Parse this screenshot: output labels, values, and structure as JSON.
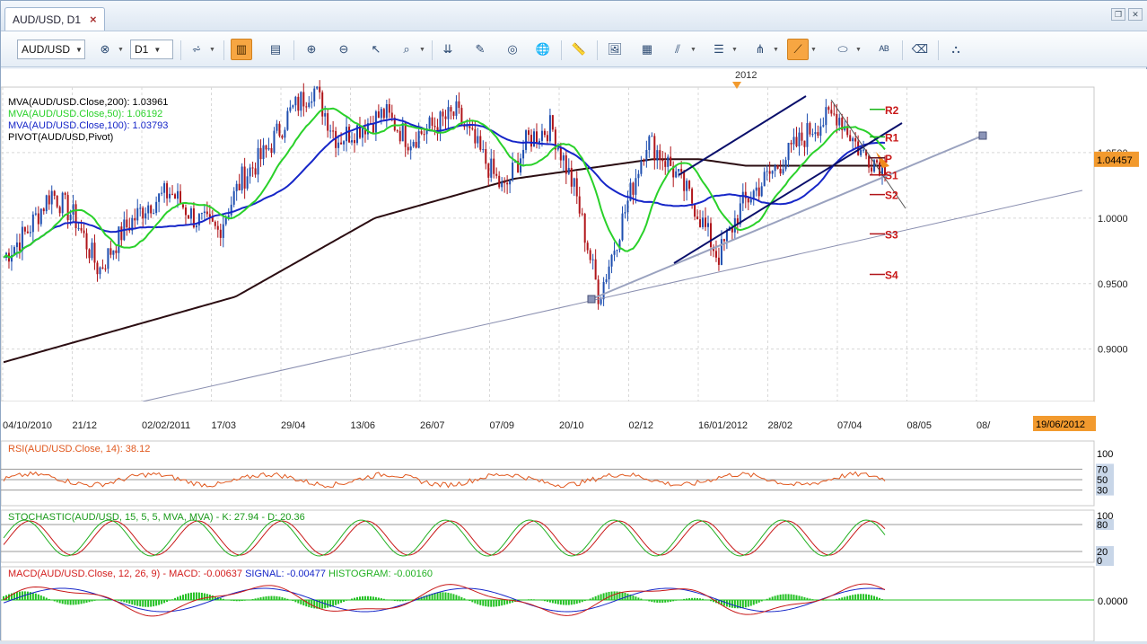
{
  "window": {
    "tab_title": "AUD/USD, D1",
    "tab_close": "×"
  },
  "toolbar": {
    "symbol": "AUD/USD",
    "timeframe": "D1",
    "icons": [
      "bar-chart-icon",
      "delete-symbol-icon",
      "chart-type-icon",
      "candles-icon",
      "indicators-icon",
      "zoom-in-icon",
      "zoom-out-icon",
      "cursor-icon",
      "zoom-area-icon",
      "autoscroll-icon",
      "grid-icon",
      "history-icon",
      "globe-icon",
      "ruler-icon",
      "screenshot-icon",
      "template-icon",
      "fibonacci-icon",
      "channel-icon",
      "pitchfork-icon",
      "trendline-icon",
      "ellipse-icon",
      "text-label-icon",
      "eraser-icon",
      "objects-tree-icon"
    ]
  },
  "main": {
    "year_marker": "2012",
    "legend": [
      {
        "text": "MVA(AUD/USD.Close,200): 1.03961",
        "color": "#2b0d12"
      },
      {
        "text": "MVA(AUD/USD.Close,50): 1.06192",
        "color": "#2ad12a"
      },
      {
        "text": "MVA(AUD/USD.Close,100): 1.03793",
        "color": "#1626c8"
      },
      {
        "text": "PIVOT(AUD/USD,Pivot)",
        "color": "#111111"
      }
    ],
    "y_ticks": [
      "1.0500",
      "1.0000",
      "0.9500",
      "0.9000"
    ],
    "price_label": "1.04457",
    "x_ticks": [
      "04/10/2010",
      "21/12",
      "02/02/2011",
      "17/03",
      "29/04",
      "13/06",
      "26/07",
      "07/09",
      "20/10",
      "02/12",
      "16/01/2012",
      "28/02",
      "07/04",
      "08/05",
      "08/"
    ],
    "date_label": "19/06/2012",
    "pivots": [
      "R2",
      "R1",
      "P",
      "S1",
      "S2",
      "S3",
      "S4"
    ]
  },
  "rsi": {
    "label": "RSI(AUD/USD.Close, 14): 38.12",
    "ticks": [
      "100",
      "70",
      "50",
      "30"
    ]
  },
  "stochastic": {
    "label": "STOCHASTIC(AUD/USD, 15, 5, 5, MVA, MVA) - K: 27.94 - D: 20.36",
    "ticks": [
      "100",
      "80",
      "20",
      "0"
    ]
  },
  "macd": {
    "label_1": "MACD(AUD/USD.Close, 12, 26, 9) - MACD: -0.00637",
    "label_2": "SIGNAL: -0.00477",
    "label_3": "HISTOGRAM: -0.00160",
    "ticks": [
      "0.0000"
    ]
  },
  "chart_data": {
    "type": "candlestick",
    "instrument": "AUD/USD",
    "timeframe": "D1",
    "ylim": [
      0.86,
      1.1
    ],
    "moving_averages": [
      {
        "name": "MVA200",
        "color": "#2b0d12",
        "last": 1.03961
      },
      {
        "name": "MVA50",
        "color": "#2ad12a",
        "last": 1.06192
      },
      {
        "name": "MVA100",
        "color": "#1626c8",
        "last": 1.03793
      }
    ],
    "close_path": [
      0.97,
      0.99,
      1.02,
      1.0,
      0.96,
      0.99,
      1.01,
      1.02,
      1.0,
      0.99,
      1.03,
      1.05,
      1.08,
      1.1,
      1.06,
      1.07,
      1.08,
      1.06,
      1.07,
      1.08,
      1.05,
      1.02,
      1.06,
      1.07,
      1.02,
      0.94,
      1.0,
      1.06,
      1.04,
      1.01,
      0.97,
      1.01,
      1.03,
      1.05,
      1.07,
      1.08,
      1.05,
      1.04
    ],
    "ma200_path": [
      0.89,
      0.9,
      0.91,
      0.92,
      0.93,
      0.94,
      0.96,
      0.98,
      1.0,
      1.01,
      1.02,
      1.03,
      1.035,
      1.04,
      1.045,
      1.045,
      1.04,
      1.04,
      1.04,
      1.04
    ],
    "pivot_levels": {
      "R2": 1.083,
      "R1": 1.062,
      "P": 1.046,
      "S1": 1.033,
      "S2": 1.018,
      "S3": 0.988,
      "S4": 0.957
    },
    "gridlines": true
  }
}
